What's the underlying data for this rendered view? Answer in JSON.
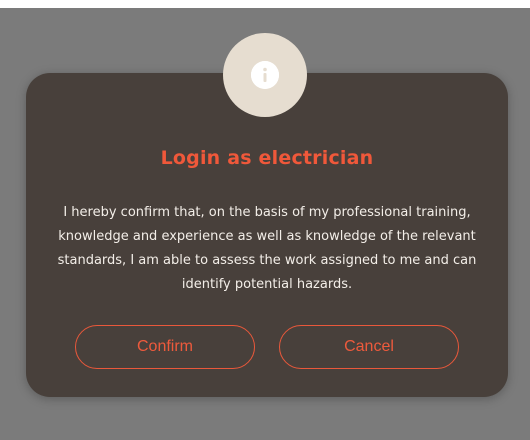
{
  "dialog": {
    "icon": "info-icon",
    "title": "Login as electrician",
    "message": "I hereby confirm that, on the basis of my professional training, knowledge and experience as well as knowledge of the relevant standards, I am able to assess the work assigned to me and can identify potential hazards.",
    "confirm_label": "Confirm",
    "cancel_label": "Cancel"
  },
  "colors": {
    "backdrop": "#7b7b7b",
    "dialog_background": "#48403b",
    "accent": "#f0583a",
    "badge": "#e6ddd0",
    "text": "#f3eee8"
  }
}
